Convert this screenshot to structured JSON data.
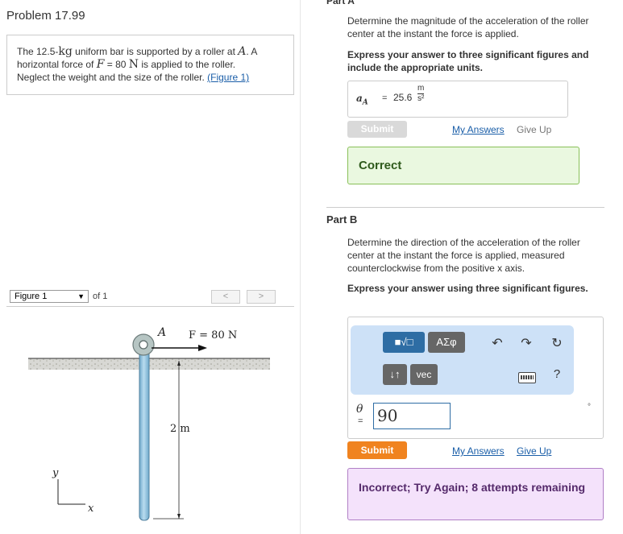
{
  "problem": {
    "title": "Problem 17.99",
    "text_a": "The 12.5-",
    "text_kg": "kg",
    "text_b": " uniform bar is supported by a roller at ",
    "text_A": "A",
    "text_c": ". A",
    "text_d": "horizontal force of ",
    "text_F": "F",
    "text_e": " = 80 ",
    "text_N": "N",
    "text_f": " is applied to the roller.",
    "text_g": "Neglect the weight and the size of the roller. ",
    "figure_link": "(Figure 1)"
  },
  "figure": {
    "select_label": "Figure 1",
    "of_label": "of 1",
    "prev": "<",
    "next": ">",
    "label_A": "A",
    "label_force": "F = 80 N",
    "label_length": "2 m",
    "label_y": "y",
    "label_x": "x"
  },
  "part_a": {
    "header_cut": "Part A",
    "question": "Determine the magnitude of the acceleration of the roller center at the instant the force is applied.",
    "instruction": "Express your answer to three significant figures and include the appropriate units.",
    "answer_label": "a",
    "answer_sub": "A",
    "equals": "=",
    "answer_value": "25.6",
    "unit_num": "m",
    "unit_den": "s²",
    "submit": "Submit",
    "my_answers": "My Answers",
    "give_up": "Give Up",
    "feedback": "Correct"
  },
  "part_b": {
    "header": "Part B",
    "question": "Determine the direction of the acceleration of the roller center at the instant the force is applied, measured counterclockwise from the positive x axis.",
    "instruction": "Express your answer using three significant figures.",
    "tb_templates": "■√□",
    "tb_greek": "ΑΣφ",
    "tb_arrows": "↓↑",
    "tb_vec": "vec",
    "tb_help": "?",
    "theta_label": "θ",
    "equals": "=",
    "answer_value": "90",
    "degree_mark": "°",
    "submit": "Submit",
    "my_answers": "My Answers",
    "give_up": "Give Up",
    "feedback": "Incorrect; Try Again; 8 attempts remaining"
  },
  "colors": {
    "accent_blue": "#1a5ea8",
    "submit_orange": "#f0831f",
    "correct_bg": "#eaf8e0",
    "incorrect_bg": "#f4e2fb",
    "bar_blue": "#8ec3e0"
  }
}
